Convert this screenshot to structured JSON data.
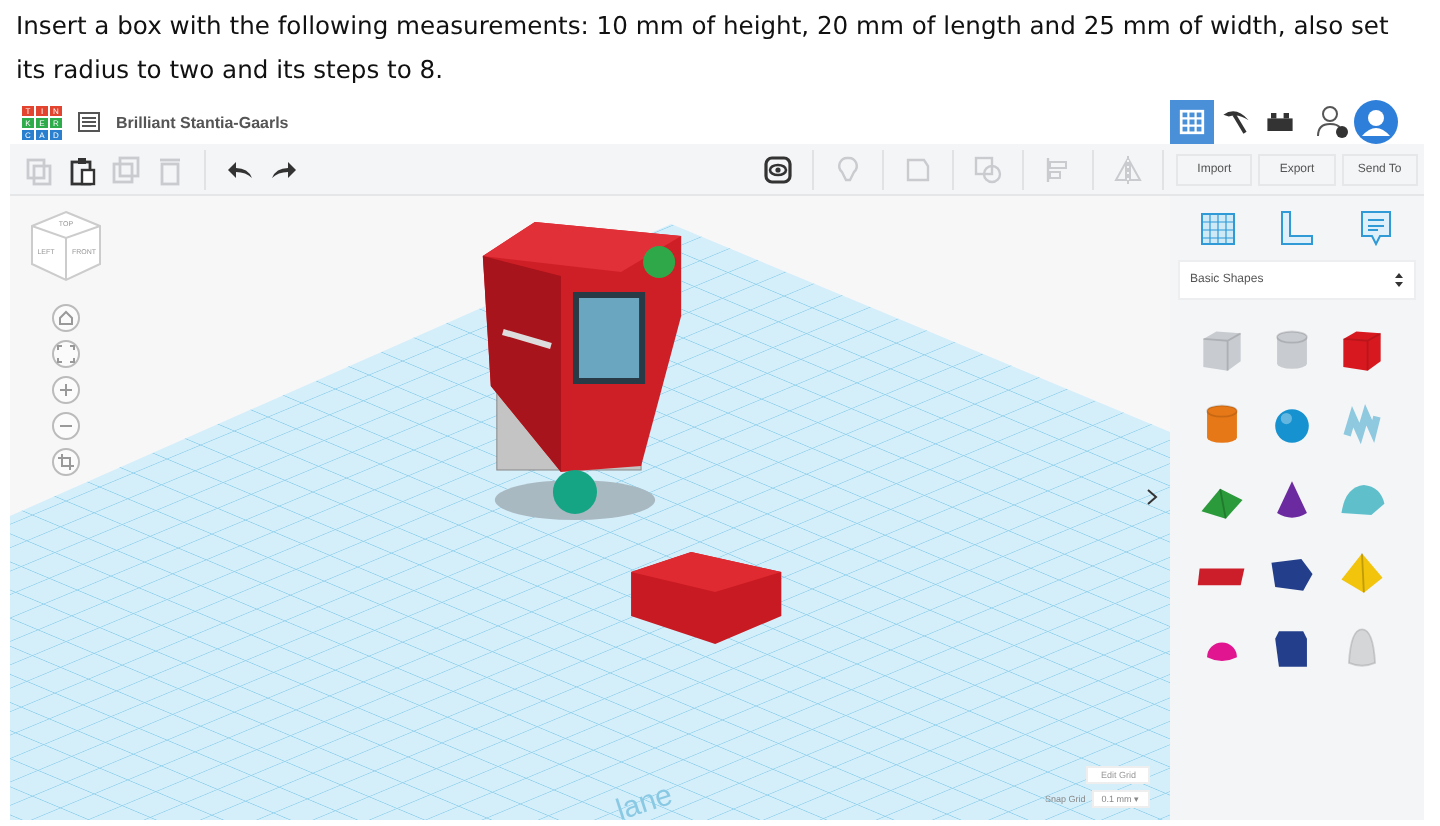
{
  "instruction": "Insert a box with the following measurements: 10 mm of height, 20 mm of length and 25 mm of width, also set its radius to two and its steps to 8.",
  "header": {
    "logo_letters": [
      "T",
      "I",
      "N",
      "K",
      "E",
      "R",
      "C",
      "A",
      "D"
    ],
    "project_name": "Brilliant Stantia-Gaarls"
  },
  "edit_tools": [
    {
      "kind": "copy",
      "disabled": true
    },
    {
      "kind": "paste",
      "disabled": false
    },
    {
      "kind": "duplicate",
      "disabled": true
    },
    {
      "kind": "delete",
      "disabled": true
    },
    {
      "kind": "undo",
      "disabled": false
    },
    {
      "kind": "redo",
      "disabled": false
    }
  ],
  "view_tools": [
    {
      "kind": "eye",
      "disabled": false
    },
    {
      "kind": "bulb",
      "disabled": true
    },
    {
      "kind": "note",
      "disabled": true
    },
    {
      "kind": "group",
      "disabled": true
    },
    {
      "kind": "align",
      "disabled": true
    },
    {
      "kind": "mirror",
      "disabled": true
    }
  ],
  "modes": [
    {
      "kind": "grid",
      "selected": true
    },
    {
      "kind": "pickaxe",
      "selected": false
    },
    {
      "kind": "bricks",
      "selected": false
    }
  ],
  "actions": [
    "Import",
    "Export",
    "Send To"
  ],
  "view_cube": {
    "faces": [
      "TOP",
      "LEFT",
      "FRONT"
    ]
  },
  "panel": {
    "helpers": [
      {
        "kind": "workplane"
      },
      {
        "kind": "ruler"
      },
      {
        "kind": "note"
      }
    ],
    "category": "Basic Shapes",
    "shapes": [
      {
        "kind": "box",
        "color": "#c8cbd0"
      },
      {
        "kind": "cylinder",
        "color": "#c8cbd0"
      },
      {
        "kind": "box",
        "color": "#d7191f"
      },
      {
        "kind": "cylinder",
        "color": "#e67817"
      },
      {
        "kind": "sphere",
        "color": "#1592cf"
      },
      {
        "kind": "scribble",
        "color": "#8fc9e0"
      },
      {
        "kind": "roof",
        "color": "#2a9a3a"
      },
      {
        "kind": "cone",
        "color": "#6b2aa0"
      },
      {
        "kind": "round-roof",
        "color": "#5fc0cc"
      },
      {
        "kind": "text",
        "color": "#cc1e2a"
      },
      {
        "kind": "polygon",
        "color": "#233f8c"
      },
      {
        "kind": "pyramid",
        "color": "#f2c40c"
      },
      {
        "kind": "half-sphere",
        "color": "#e0158f"
      },
      {
        "kind": "prism",
        "color": "#233f8c"
      },
      {
        "kind": "paraboloid",
        "color": "#d4d6d8"
      }
    ]
  },
  "workplane": {
    "label": "lane",
    "edit_grid": "Edit Grid",
    "snap_grid_label": "Snap Grid",
    "snap_value": "0.1 mm ▾"
  }
}
